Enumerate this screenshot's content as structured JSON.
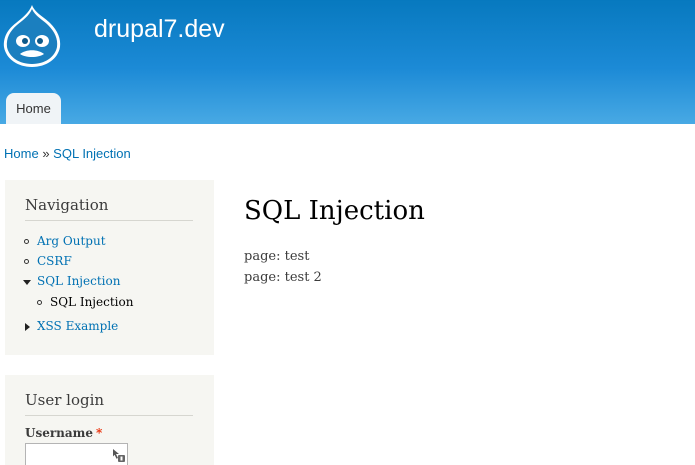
{
  "header": {
    "site_name": "drupal7.dev",
    "tabs": [
      {
        "label": "Home"
      }
    ]
  },
  "breadcrumb": {
    "items": [
      {
        "label": "Home"
      },
      {
        "label": "SQL Injection"
      }
    ],
    "separator": "»"
  },
  "navigation": {
    "title": "Navigation",
    "items": [
      {
        "label": "Arg Output",
        "marker": "circle"
      },
      {
        "label": "CSRF",
        "marker": "circle"
      },
      {
        "label": "SQL Injection",
        "marker": "expanded"
      },
      {
        "label": "SQL Injection",
        "marker": "circle",
        "active": true
      },
      {
        "label": "XSS Example",
        "marker": "collapsed"
      }
    ]
  },
  "user_login": {
    "title": "User login",
    "username_label": "Username",
    "required_mark": "*",
    "username_value": ""
  },
  "content": {
    "title": "SQL Injection",
    "lines": [
      "page: test",
      "page: test 2"
    ]
  },
  "colors": {
    "header_top": "#0779bf",
    "header_bottom": "#48a9e4",
    "link": "#0071b3",
    "sidebar_bg": "#f6f6f2",
    "required": "#ea2800"
  }
}
